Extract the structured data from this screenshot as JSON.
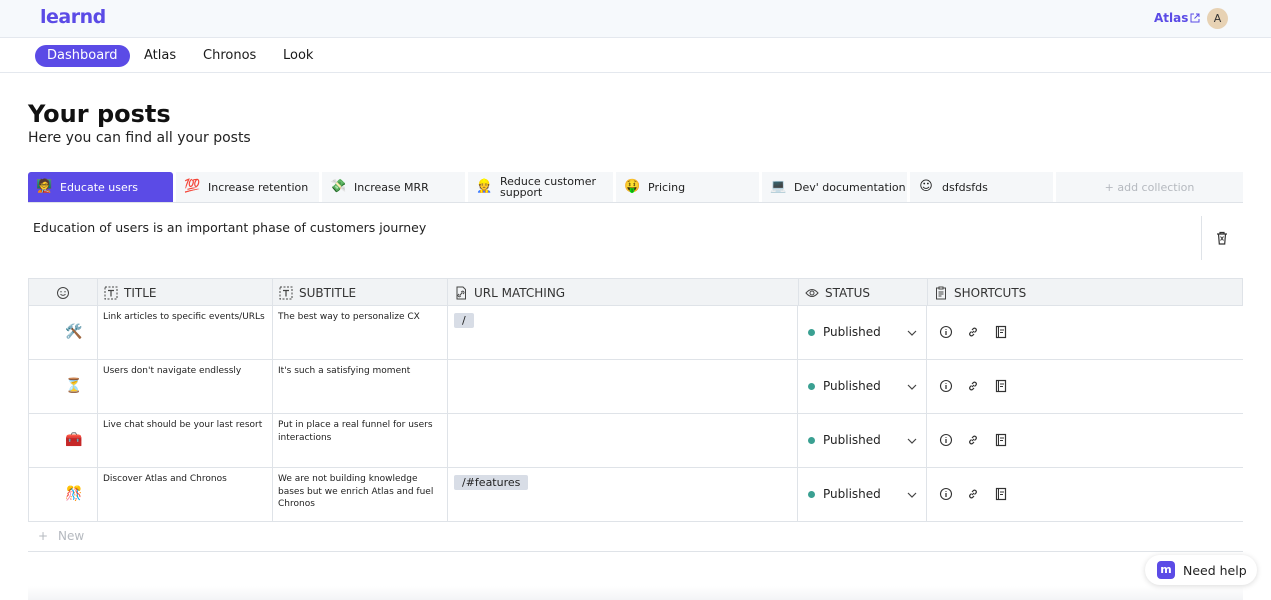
{
  "app": {
    "logo": "learnd"
  },
  "header": {
    "atlas_link": "Atlas",
    "avatar_letter": "A"
  },
  "nav": {
    "tabs": [
      "Dashboard",
      "Atlas",
      "Chronos",
      "Look"
    ],
    "active": "Dashboard"
  },
  "page": {
    "title": "Your posts",
    "subtitle": "Here you can find all your posts"
  },
  "collections": {
    "items": [
      {
        "emoji": "🧑‍🏫",
        "label": "Educate users"
      },
      {
        "emoji": "💯",
        "label": "Increase retention"
      },
      {
        "emoji": "💸",
        "label": "Increase MRR"
      },
      {
        "emoji": "👷",
        "label": "Reduce customer support"
      },
      {
        "emoji": "🤑",
        "label": "Pricing"
      },
      {
        "emoji": "💻",
        "label": "Dev' documentation"
      },
      {
        "emoji": "☺",
        "label": "dsfdsfds"
      }
    ],
    "add_label": "+ add collection",
    "description": "Education of users is an important phase of customers journey"
  },
  "table": {
    "columns": [
      "TITLE",
      "SUBTITLE",
      "URL MATCHING",
      "STATUS",
      "SHORTCUTS"
    ],
    "rows": [
      {
        "icon": "🛠️",
        "title": "Link articles to specific events/URLs",
        "subtitle": "The best way to personalize CX",
        "url": "/",
        "status": "Published"
      },
      {
        "icon": "⏳",
        "title": "Users don't navigate endlessly",
        "subtitle": "It's such a satisfying moment",
        "url": "",
        "status": "Published"
      },
      {
        "icon": "🧰",
        "title": "Live chat should be your last resort",
        "subtitle": "Put in place a real funnel for users interactions",
        "url": "",
        "status": "Published"
      },
      {
        "icon": "🎊",
        "title": "Discover Atlas and Chronos",
        "subtitle": "We are not building knowledge bases but we enrich Atlas and fuel Chronos",
        "url": "/#features",
        "status": "Published"
      }
    ],
    "new_label": "New"
  },
  "help": {
    "label": "Need help",
    "logo_letter": "m"
  },
  "colors": {
    "accent": "#5b4be6",
    "published": "#3aa092"
  }
}
